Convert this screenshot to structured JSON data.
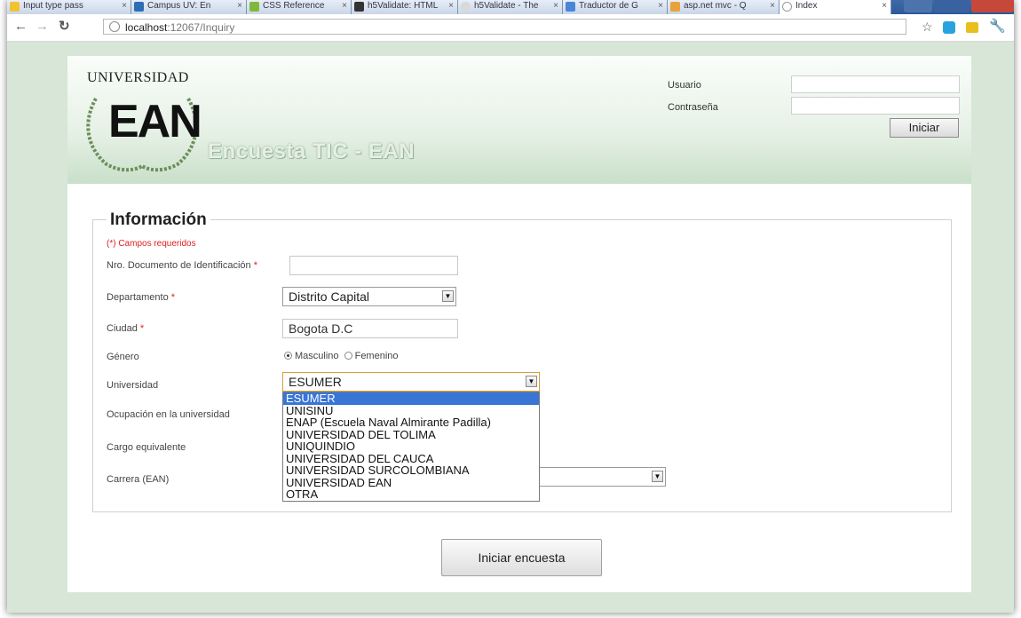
{
  "browser": {
    "tabs": [
      {
        "label": "Input type pass",
        "active": false
      },
      {
        "label": "Campus UV: En",
        "active": false
      },
      {
        "label": "CSS Reference",
        "active": false
      },
      {
        "label": "h5Validate: HTML",
        "active": false
      },
      {
        "label": "h5Validate - The",
        "active": false
      },
      {
        "label": "Traductor de G",
        "active": false
      },
      {
        "label": "asp.net mvc - Q",
        "active": false
      },
      {
        "label": "Index",
        "active": true
      }
    ],
    "url_host": "localhost",
    "url_rest": ":12067/Inquiry"
  },
  "header": {
    "logo_top": "UNIVERSIDAD",
    "logo_main": "EAN",
    "site_title": "Encuesta TIC - EAN",
    "user_label": "Usuario",
    "password_label": "Contraseña",
    "login_button": "Iniciar"
  },
  "form": {
    "legend": "Información",
    "required_note": "(*) Campos requeridos",
    "fields": {
      "documento": {
        "label": "Nro. Documento de Identificación",
        "value": ""
      },
      "departamento": {
        "label": "Departamento",
        "value": "Distrito Capital"
      },
      "ciudad": {
        "label": "Ciudad",
        "value": "Bogota D.C"
      },
      "genero": {
        "label": "Género",
        "option_male": "Masculino",
        "option_female": "Femenino",
        "selected": "Masculino"
      },
      "universidad": {
        "label": "Universidad",
        "value": "ESUMER"
      },
      "ocupacion": {
        "label": "Ocupación en la universidad"
      },
      "cargo": {
        "label": "Cargo equivalente"
      },
      "carrera": {
        "label": "Carrera (EAN)"
      }
    },
    "required_marker": "*",
    "university_options": [
      "ESUMER",
      "UNISINU",
      "ENAP (Escuela Naval Almirante Padilla)",
      "UNIVERSIDAD DEL TOLIMA",
      "UNIQUINDIO",
      "UNIVERSIDAD DEL CAUCA",
      "UNIVERSIDAD SURCOLOMBIANA",
      "UNIVERSIDAD EAN",
      "OTRA"
    ],
    "submit_button": "Iniciar encuesta"
  },
  "colors": {
    "page_bg": "#d7e6d7",
    "highlight": "#3875d7",
    "required": "#e02020"
  }
}
